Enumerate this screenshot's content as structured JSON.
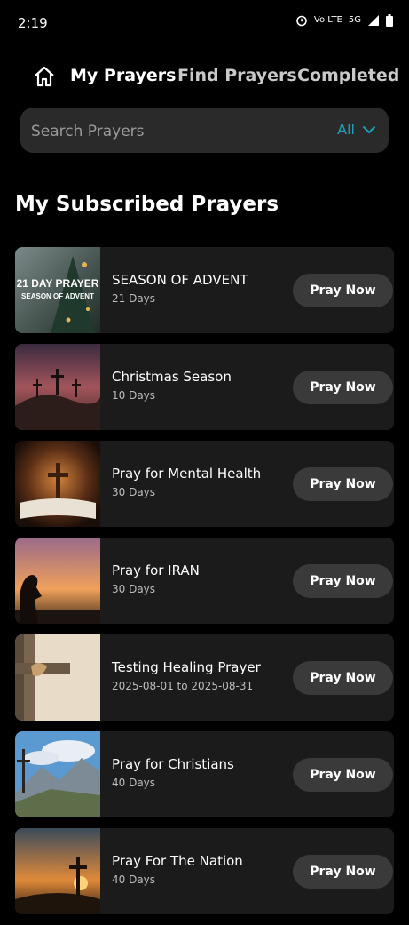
{
  "status_bar": {
    "time": "2:19",
    "network": "Vo LTE",
    "generation": "5G"
  },
  "nav": {
    "home_icon": "home-icon",
    "tabs": [
      {
        "label": "My Prayers",
        "active": true
      },
      {
        "label": "Find Prayers",
        "active": false
      },
      {
        "label": "Completed",
        "active": false
      }
    ]
  },
  "search": {
    "placeholder": "Search Prayers",
    "filter_label": "All"
  },
  "section_title": "My Subscribed Prayers",
  "prayers": [
    {
      "title": "SEASON OF ADVENT",
      "subtitle": "21 Days",
      "button": "Pray Now",
      "thumb_text_1": "21 DAY PRAYER",
      "thumb_text_2": "SEASON OF ADVENT"
    },
    {
      "title": "Christmas Season",
      "subtitle": "10 Days",
      "button": "Pray Now"
    },
    {
      "title": "Pray for Mental Health",
      "subtitle": "30 Days",
      "button": "Pray Now"
    },
    {
      "title": "Pray for IRAN",
      "subtitle": "30 Days",
      "button": "Pray Now"
    },
    {
      "title": "Testing Healing Prayer",
      "subtitle": "2025-08-01 to 2025-08-31",
      "button": "Pray Now"
    },
    {
      "title": "Pray for Christians",
      "subtitle": "40 Days",
      "button": "Pray Now"
    },
    {
      "title": "Pray For The Nation",
      "subtitle": "40 Days",
      "button": "Pray Now"
    }
  ],
  "colors": {
    "accent": "#1f9fb8",
    "card_bg": "#1b1b1b",
    "button_bg": "#3a3a3a"
  }
}
